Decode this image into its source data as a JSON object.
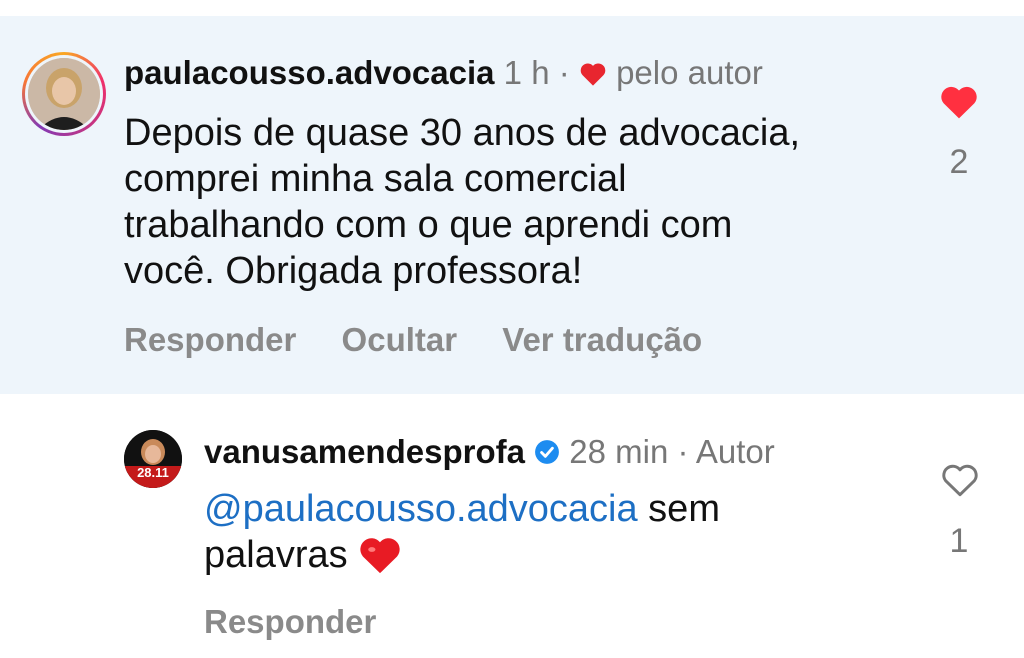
{
  "comment": {
    "username": "paulacousso.advocacia",
    "time": "1 h",
    "separator": "·",
    "liked_by_author": "pelo autor",
    "lines": [
      "Depois de quase 30 anos de advocacia,",
      "comprei minha sala comercial",
      "trabalhando com o que aprendi com",
      "você.  Obrigada professora!"
    ],
    "actions": {
      "reply": "Responder",
      "hide": "Ocultar",
      "translate": "Ver tradução"
    },
    "like_count": "2",
    "liked": true
  },
  "reply": {
    "username": "vanusamendesprofa",
    "verified": true,
    "time": "28 min",
    "separator": "·",
    "role": "Autor",
    "mention": "@paulacousso.advocacia",
    "text_after_mention": " sem",
    "line2": "palavras",
    "emoji": "❤️",
    "avatar_text": "28.11",
    "actions": {
      "reply": "Responder"
    },
    "like_count": "1",
    "liked": false
  },
  "colors": {
    "highlight_bg": "#eef5fb",
    "like_red": "#ff3040",
    "link_blue": "#1d6fc4",
    "muted": "#777777"
  }
}
